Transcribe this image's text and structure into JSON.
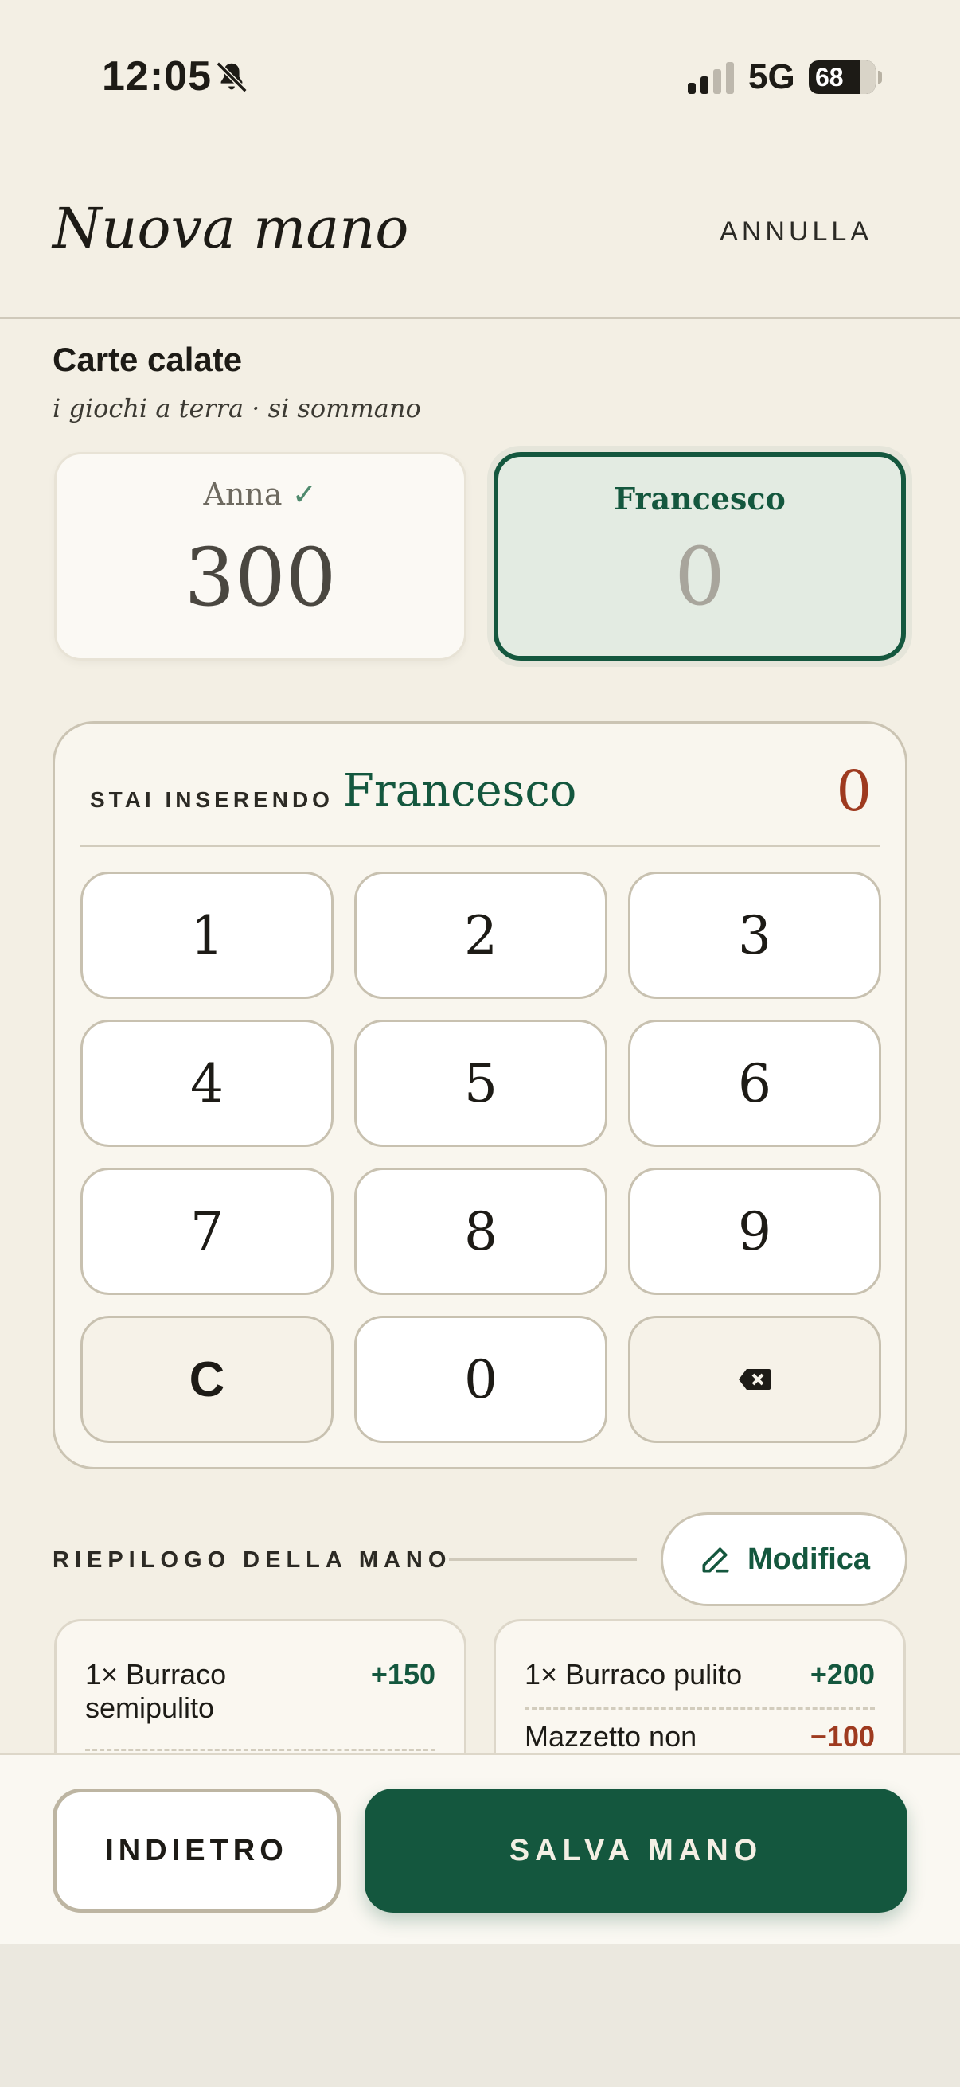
{
  "status": {
    "time": "12:05",
    "network": "5G",
    "battery": "68"
  },
  "header": {
    "title": "Nuova mano",
    "cancel_label": "ANNULLA"
  },
  "section": {
    "title": "Carte calate",
    "subtitle": "i giochi a terra · si sommano"
  },
  "players": [
    {
      "name": "Anna",
      "check": "✓",
      "score": "300"
    },
    {
      "name": "Francesco",
      "score": "0"
    }
  ],
  "keypad": {
    "entering_label": "STAI INSERENDO",
    "entering_name": "Francesco",
    "entering_value": "0",
    "keys": [
      "1",
      "2",
      "3",
      "4",
      "5",
      "6",
      "7",
      "8",
      "9",
      "C",
      "0",
      "⌫"
    ]
  },
  "summary": {
    "label": "RIEPILOGO DELLA MANO",
    "edit_label": "Modifica",
    "left": [
      {
        "line1": "1× Burraco",
        "line2": "semipulito",
        "points": "+150"
      }
    ],
    "right": [
      {
        "text": "1× Burraco pulito",
        "points": "+200"
      },
      {
        "text": "Mazzetto non",
        "points": "−100"
      }
    ]
  },
  "actions": {
    "back_label": "INDIETRO",
    "save_label": "SALVA MANO"
  },
  "colors": {
    "primary": "#14573e",
    "negative": "#9e3a1f",
    "background": "#f3efe4"
  }
}
